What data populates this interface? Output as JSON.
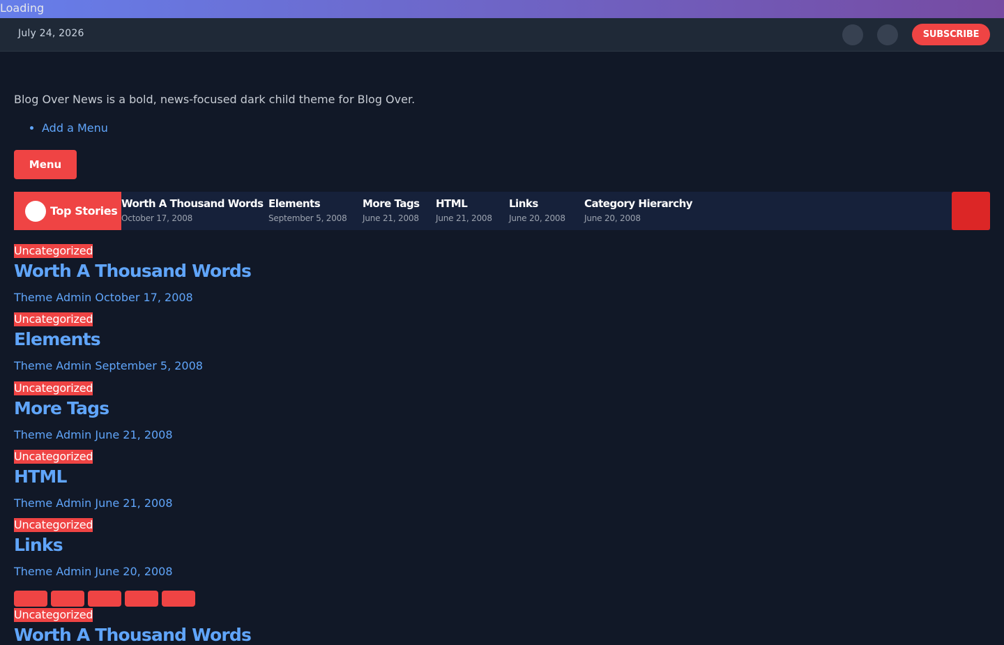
{
  "loading": {
    "text": "Loading"
  },
  "topbar": {
    "date": "July 24, 2026",
    "subscribe_label": "SUBSCRIBE"
  },
  "site": {
    "tagline": "Blog Over News is a bold, news-focused dark child theme for Blog Over.",
    "menu_items": [
      "Add a Menu"
    ],
    "menu_button": "Menu"
  },
  "ticker": {
    "label": "Top Stories",
    "items": [
      {
        "title": "Worth A Thousand Words",
        "date": "October 17, 2008"
      },
      {
        "title": "Elements",
        "date": "September 5, 2008"
      },
      {
        "title": "More Tags",
        "date": "June 21, 2008"
      },
      {
        "title": "HTML",
        "date": "June 21, 2008"
      },
      {
        "title": "Links",
        "date": "June 20, 2008"
      },
      {
        "title": "Category Hierarchy",
        "date": "June 20, 2008"
      }
    ]
  },
  "posts": [
    {
      "category": "Uncategorized",
      "title": "Worth A Thousand Words",
      "author": "Theme Admin",
      "date": "October 17, 2008"
    },
    {
      "category": "Uncategorized",
      "title": "Elements",
      "author": "Theme Admin",
      "date": "September 5, 2008"
    },
    {
      "category": "Uncategorized",
      "title": "More Tags",
      "author": "Theme Admin",
      "date": "June 21, 2008"
    },
    {
      "category": "Uncategorized",
      "title": "HTML",
      "author": "Theme Admin",
      "date": "June 21, 2008"
    },
    {
      "category": "Uncategorized",
      "title": "Links",
      "author": "Theme Admin",
      "date": "June 20, 2008"
    }
  ],
  "partial_post": {
    "category": "Uncategorized",
    "title": "Worth A Thousand Words"
  },
  "colors": {
    "accent": "#ef4444",
    "link": "#60a5fa",
    "background": "#111827",
    "bar": "#1f2937"
  }
}
